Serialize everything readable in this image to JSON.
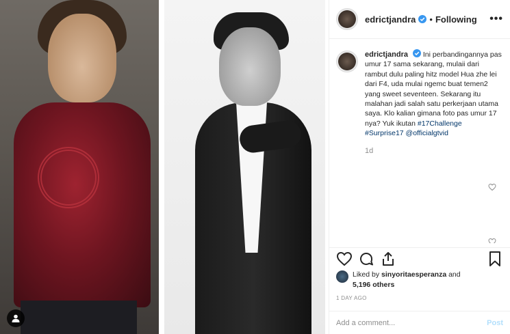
{
  "post": {
    "username": "edrictjandra",
    "follow_separator": "•",
    "follow_status": "Following",
    "more_label": "•••"
  },
  "caption": {
    "username": "edrictjandra",
    "text": "Ini perbandingannya pas umur 17 sama sekarang, mulaii dari rambut dulu paling hitz model Hua zhe lei dari F4, uda mulai ngemc buat temen2 yang sweet seventeen. Sekarang itu malahan jadi salah satu perkerjaan utama saya. Klo kalian gimana foto pas umur 17 nya? Yuk ikutan",
    "hashtag1": "#17Challenge",
    "hashtag2": "#Surprise17",
    "mention": "@officialgtvid",
    "age": "1d"
  },
  "likes": {
    "prefix": "Liked by",
    "liker": "sinyoritaesperanza",
    "and": "and",
    "others": "5,196 others"
  },
  "timestamp": "1 DAY AGO",
  "comment_box": {
    "placeholder": "Add a comment...",
    "post_label": "Post"
  },
  "colors": {
    "text": "#262626",
    "muted": "#8e8e8e",
    "link": "#003569",
    "verified": "#3897f0",
    "post_disabled": "#b2dffc"
  },
  "icons": [
    "user-tag-icon",
    "verified-icon",
    "heart-icon",
    "comment-icon",
    "share-icon",
    "bookmark-icon"
  ]
}
